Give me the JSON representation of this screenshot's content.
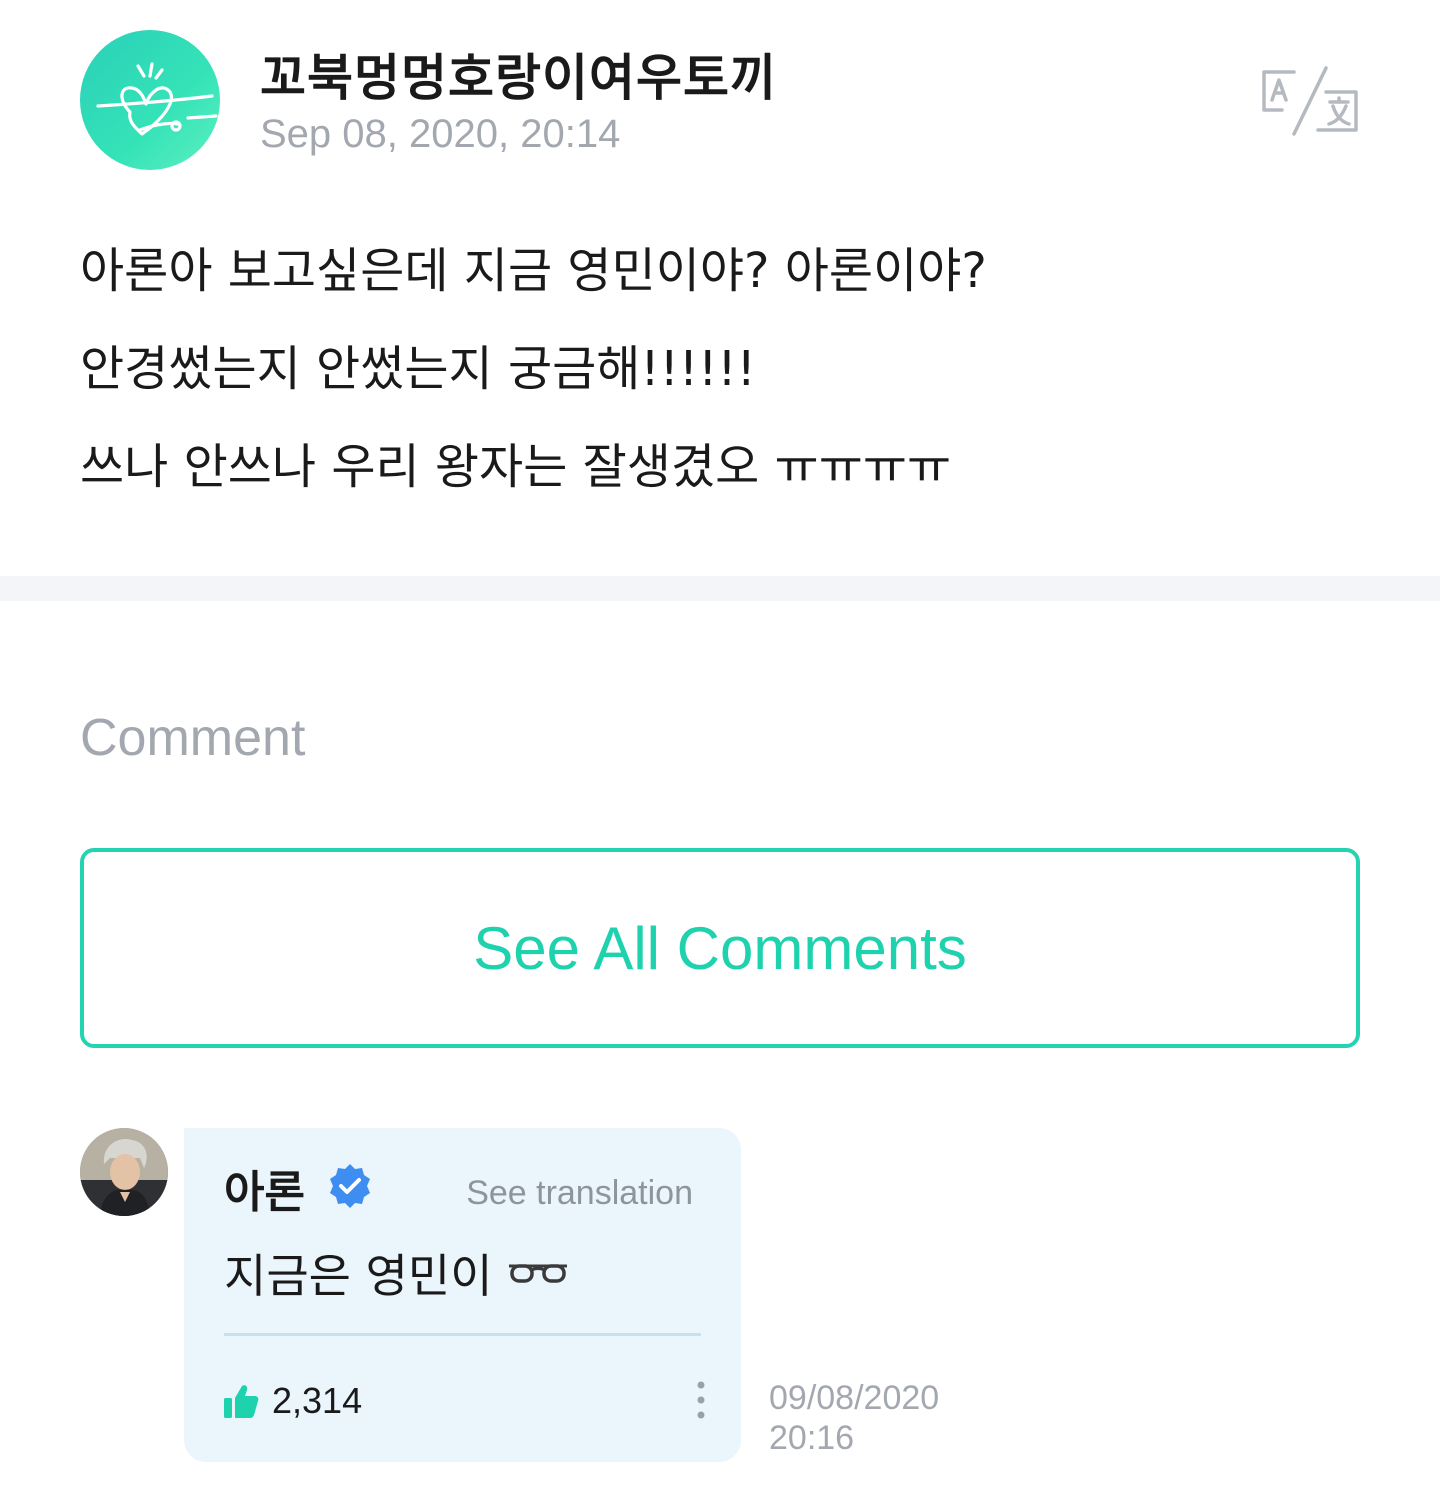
{
  "post": {
    "author": "꼬북멍멍호랑이여우토끼",
    "date": "Sep 08, 2020, 20:14",
    "lines": [
      "아론아 보고싶은데 지금 영민이야? 아론이야?",
      "안경썼는지 안썼는지 궁금해!!!!!!",
      "쓰나 안쓰나 우리 왕자는 잘생겼오 ㅠㅠㅠㅠ"
    ],
    "translate_icon": "translate-icon"
  },
  "comments_section": {
    "heading": "Comment",
    "see_all_label": "See All Comments"
  },
  "comment": {
    "author": "아론",
    "verified": true,
    "see_translation_label": "See translation",
    "text": "지금은 영민이",
    "emoji": "glasses-icon",
    "likes": "2,314",
    "date": "09/08/2020",
    "time": "20:16"
  },
  "colors": {
    "accent": "#1fd2ae",
    "bubble": "#eaf5fc",
    "muted": "#a3a8b0",
    "verified": "#3d8ef0"
  }
}
